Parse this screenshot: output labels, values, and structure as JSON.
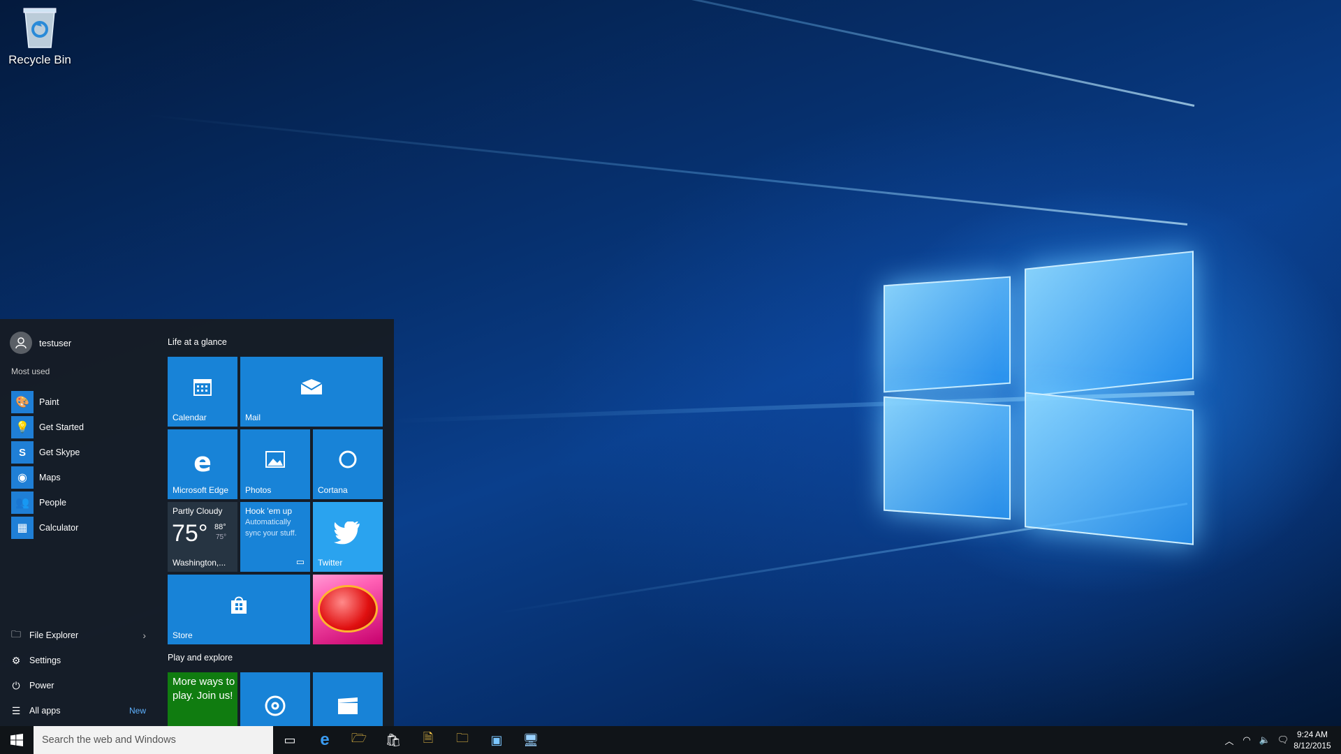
{
  "desktop": {
    "recycle_bin": "Recycle Bin"
  },
  "start_menu": {
    "user": "testuser",
    "most_used_title": "Most used",
    "most_used": [
      {
        "label": "Paint",
        "icon": "paint-icon"
      },
      {
        "label": "Get Started",
        "icon": "lightbulb-icon"
      },
      {
        "label": "Get Skype",
        "icon": "skype-icon"
      },
      {
        "label": "Maps",
        "icon": "maps-icon"
      },
      {
        "label": "People",
        "icon": "people-icon"
      },
      {
        "label": "Calculator",
        "icon": "calculator-icon"
      }
    ],
    "bottom": {
      "file_explorer": "File Explorer",
      "settings": "Settings",
      "power": "Power",
      "all_apps": "All apps",
      "new_badge": "New"
    },
    "groups": {
      "life": "Life at a glance",
      "play": "Play and explore"
    },
    "tiles": {
      "calendar": "Calendar",
      "mail": "Mail",
      "edge": "Microsoft Edge",
      "photos": "Photos",
      "cortana": "Cortana",
      "weather_condition": "Partly Cloudy",
      "weather_temp": "75°",
      "weather_high": "88°",
      "weather_low": "75°",
      "weather_location": "Washington,...",
      "hook_title": "Hook 'em up",
      "hook_body": "Automatically sync your stuff.",
      "twitter": "Twitter",
      "store": "Store",
      "more_ways": "More ways to play. Join us!"
    },
    "accent_color": "#1883d7"
  },
  "taskbar": {
    "search_placeholder": "Search the web and Windows",
    "time": "9:24 AM",
    "date": "8/12/2015"
  }
}
